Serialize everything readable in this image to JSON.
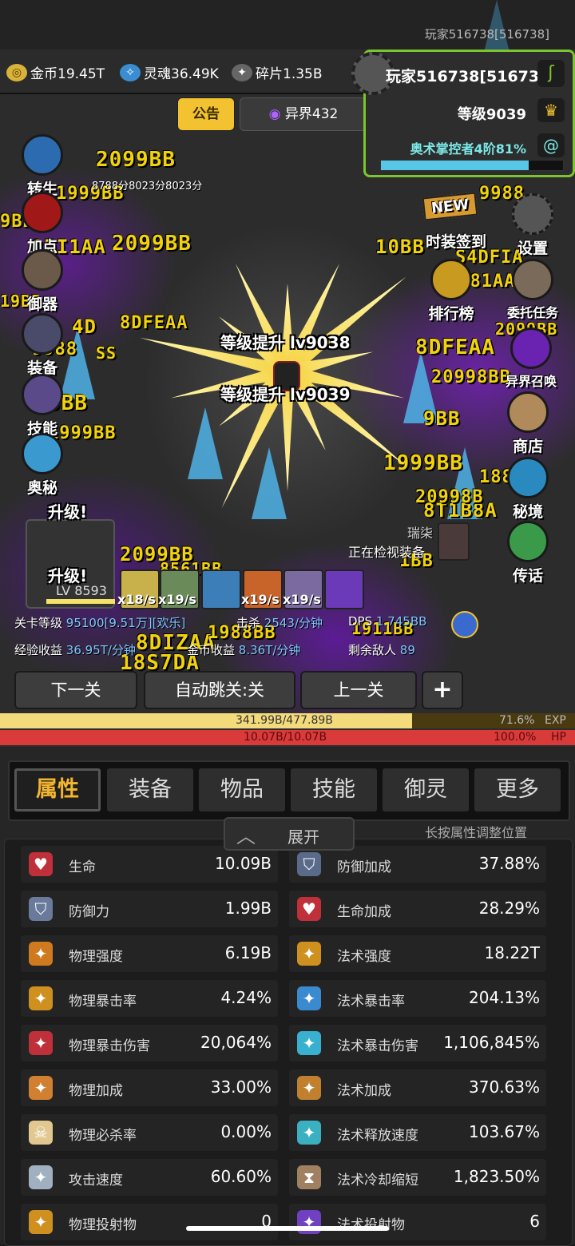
{
  "header": {
    "player_tag": "玩家516738[516738]"
  },
  "resources": [
    {
      "icon": "gold-coin-icon",
      "label": "金币19.45T"
    },
    {
      "icon": "soul-icon",
      "label": "灵魂36.49K"
    },
    {
      "icon": "shard-icon",
      "label": "碎片1.35B"
    }
  ],
  "player_panel": {
    "name": "玩家516738[516738]",
    "level": "等级9039",
    "rank": "奥术掌控者4阶81%",
    "rank_progress": 0.81
  },
  "notice": {
    "label": "公告"
  },
  "otherworld": {
    "label": "异界432"
  },
  "left_menu": [
    {
      "name": "rebirth",
      "label": "转生"
    },
    {
      "name": "add-points",
      "label": "加点"
    },
    {
      "name": "control",
      "label": "御器"
    },
    {
      "name": "equipment",
      "label": "装备"
    },
    {
      "name": "skills",
      "label": "技能"
    },
    {
      "name": "arcane",
      "label": "奥秘"
    }
  ],
  "right_menu": [
    {
      "name": "fashion-signin",
      "label": "时装签到",
      "badge": "NEW"
    },
    {
      "name": "settings",
      "label": "设置"
    },
    {
      "name": "leaderboard",
      "label": "排行榜"
    },
    {
      "name": "commission",
      "label": "委托任务"
    },
    {
      "name": "otherworld-summon",
      "label": "异界召唤"
    },
    {
      "name": "shop",
      "label": "商店"
    },
    {
      "name": "secret-realm",
      "label": "秘境"
    },
    {
      "name": "teleport",
      "label": "传话"
    }
  ],
  "battle": {
    "levelup_1": "等级提升 lv9038",
    "levelup_2": "等级提升 lv9039",
    "upgrade_1": "升级!",
    "upgrade_2": "升级!",
    "hero_level": "LV 8593",
    "npc_name": "瑞柒",
    "checking": "正在检视装备",
    "timer_text": "8788分8023分8023分"
  },
  "skills": [
    {
      "color": "#c8b04a",
      "rate": "x18/s"
    },
    {
      "color": "#6a8a5a",
      "rate": "x19/s"
    },
    {
      "color": "#3c7fb8",
      "rate": "x19/s"
    },
    {
      "color": "#c8642a",
      "rate": "x19/s"
    },
    {
      "color": "#7a6aa0",
      "rate": ""
    },
    {
      "color": "#6a3ab8",
      "rate": ""
    }
  ],
  "skill_rates_extra": "x19/s",
  "stats_line1": {
    "stage_label": "关卡等级",
    "stage_value": "95100[9.51万][欢乐]",
    "kill_label": "击杀",
    "kill_value": "2543/分钟",
    "dps_label": "DPS",
    "dps_value": "1.745BB"
  },
  "stats_line2": {
    "exp_label": "经验收益",
    "exp_value": "36.95T/分钟",
    "gold_label": "金币收益",
    "gold_value": "8.36T/分钟",
    "enemies_label": "剩余敌人",
    "enemies_value": "89"
  },
  "nav": {
    "next": "下一关",
    "auto": "自动跳关:关",
    "prev": "上一关",
    "plus": "+"
  },
  "exp_bar": {
    "text": "341.99B/477.89B",
    "percent_text": "71.6%",
    "label": "EXP",
    "fraction": 0.716
  },
  "hp_bar": {
    "text": "10.07B/10.07B",
    "percent_text": "100.0%",
    "label": "HP",
    "fraction": 1.0
  },
  "tabs": [
    "属性",
    "装备",
    "物品",
    "技能",
    "御灵",
    "更多"
  ],
  "expand": {
    "label": "展开",
    "hint": "长按属性调整位置"
  },
  "attributes": [
    {
      "icon": "heart-icon",
      "label": "生命",
      "value": "10.09B"
    },
    {
      "icon": "defense-bonus-icon",
      "label": "防御加成",
      "value": "37.88%"
    },
    {
      "icon": "shield-icon",
      "label": "防御力",
      "value": "1.99B"
    },
    {
      "icon": "life-bonus-icon",
      "label": "生命加成",
      "value": "28.29%"
    },
    {
      "icon": "physical-power-icon",
      "label": "物理强度",
      "value": "6.19B"
    },
    {
      "icon": "magic-power-icon",
      "label": "法术强度",
      "value": "18.22T"
    },
    {
      "icon": "physical-crit-icon",
      "label": "物理暴击率",
      "value": "4.24%"
    },
    {
      "icon": "magic-crit-icon",
      "label": "法术暴击率",
      "value": "204.13%"
    },
    {
      "icon": "physical-crit-dmg-icon",
      "label": "物理暴击伤害",
      "value": "20,064%"
    },
    {
      "icon": "magic-crit-dmg-icon",
      "label": "法术暴击伤害",
      "value": "1,106,845%"
    },
    {
      "icon": "physical-bonus-icon",
      "label": "物理加成",
      "value": "33.00%"
    },
    {
      "icon": "magic-bonus-icon",
      "label": "法术加成",
      "value": "370.63%"
    },
    {
      "icon": "skull-icon",
      "label": "物理必杀率",
      "value": "0.00%"
    },
    {
      "icon": "cast-speed-icon",
      "label": "法术释放速度",
      "value": "103.67%"
    },
    {
      "icon": "attack-speed-icon",
      "label": "攻击速度",
      "value": "60.60%"
    },
    {
      "icon": "hourglass-icon",
      "label": "法术冷却缩短",
      "value": "1,823.50%"
    },
    {
      "icon": "physical-projectile-icon",
      "label": "物理投射物",
      "value": "0"
    },
    {
      "icon": "magic-projectile-icon",
      "label": "法术投射物",
      "value": "6"
    }
  ],
  "floating_numbers": [
    "2099BB",
    "1999BB",
    "9BB",
    "8ZI1AA",
    "2099BB",
    "19BB",
    "4D",
    "8DFEAA",
    "9988",
    "SS",
    "9BB",
    "10BB",
    "S4DFIA",
    "8DFEAA",
    "20998BB",
    "9BB",
    "1999BB",
    "1881AA",
    "8T1B8A",
    "1BB",
    "2099BB",
    "8561BB",
    "8DIZAA",
    "1988BB",
    "18S7DA",
    "1911BB",
    "S881AAA",
    "9988",
    "2099BB",
    "20998B",
    "1999BB"
  ]
}
